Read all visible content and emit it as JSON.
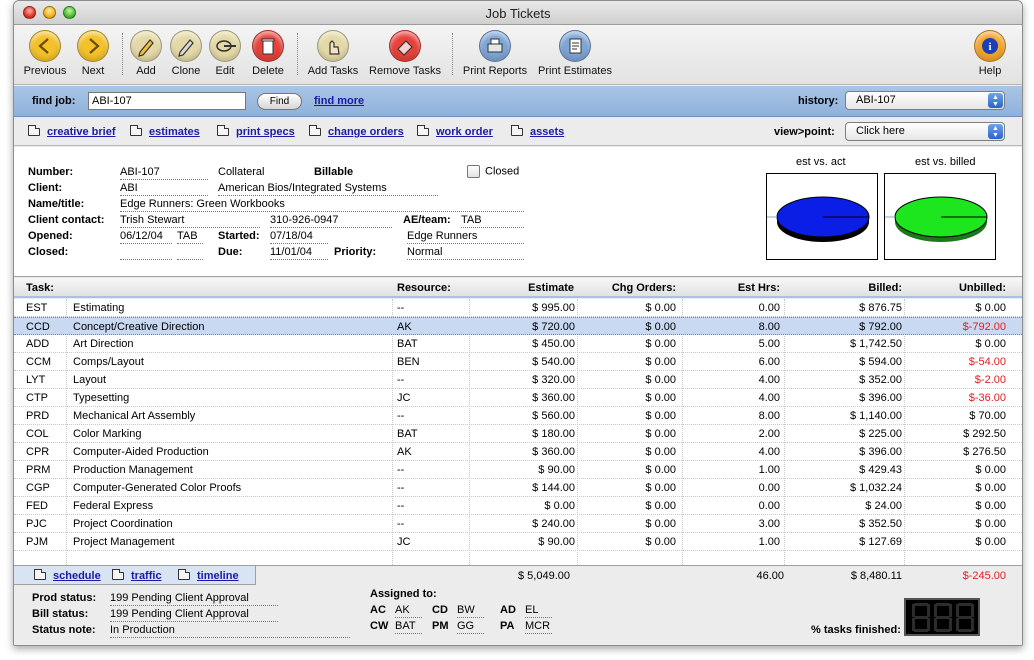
{
  "window": {
    "title": "Job Tickets"
  },
  "toolbar": {
    "items": [
      {
        "label": "Previous",
        "icon": "arrow-left-icon",
        "color": "#f3c12a"
      },
      {
        "label": "Next",
        "icon": "arrow-right-icon",
        "color": "#f3c12a"
      },
      {
        "label": "Add",
        "icon": "pencil-icon",
        "color": "#e4d9a6"
      },
      {
        "label": "Clone",
        "icon": "pencil-clone-icon",
        "color": "#e4d9a6"
      },
      {
        "label": "Edit",
        "icon": "pen-edit-icon",
        "color": "#e4d9a6"
      },
      {
        "label": "Delete",
        "icon": "trash-icon",
        "color": "#e8413a"
      },
      {
        "label": "Add Tasks",
        "icon": "hand-add-icon",
        "color": "#e4d9a6"
      },
      {
        "label": "Remove Tasks",
        "icon": "eraser-icon",
        "color": "#e8413a"
      },
      {
        "label": "Print Reports",
        "icon": "printer-icon",
        "color": "#7da5d6"
      },
      {
        "label": "Print Estimates",
        "icon": "document-print-icon",
        "color": "#7da5d6"
      },
      {
        "label": "Help",
        "icon": "info-icon",
        "color": "#f3a52a"
      }
    ]
  },
  "findbar": {
    "label": "find job:",
    "value": "ABI-107",
    "button": "Find",
    "more_link": "find more",
    "history_label": "history:",
    "history_value": "ABI-107"
  },
  "tabs": {
    "links": [
      "creative brief",
      "estimates",
      "print specs",
      "change orders",
      "work order",
      "assets"
    ],
    "view_label": "view>point:",
    "view_value": "Click here"
  },
  "job": {
    "number_label": "Number:",
    "number": "ABI-107",
    "type": "Collateral",
    "billable": "Billable",
    "closed_label": "Closed",
    "client_label": "Client:",
    "client_code": "ABI",
    "client_name": "American Bios/Integrated Systems",
    "name_label": "Name/title:",
    "name": "Edge Runners:  Green Workbooks",
    "contact_label": "Client contact:",
    "contact": "Trish Stewart",
    "phone": "310-926-0947",
    "ae_label": "AE/team:",
    "ae": "TAB",
    "team": "Edge Runners",
    "opened_label": "Opened:",
    "opened": "06/12/04",
    "opened_by": "TAB",
    "started_label": "Started:",
    "started": "07/18/04",
    "closed_date_label": "Closed:",
    "due_label": "Due:",
    "due": "11/01/04",
    "priority_label": "Priority:",
    "priority": "Normal"
  },
  "pies": {
    "est_vs_act": {
      "title": "est vs. act",
      "color": "#0a1ee6"
    },
    "est_vs_billed": {
      "title": "est vs. billed",
      "color": "#1ee61e"
    }
  },
  "table": {
    "headers": [
      "Task:",
      "Resource:",
      "Estimate",
      "Chg Orders:",
      "Est Hrs:",
      "Billed:",
      "Unbilled:"
    ],
    "rows": [
      {
        "code": "EST",
        "task": "Estimating",
        "resource": "--",
        "estimate": "$ 995.00",
        "chg": "$ 0.00",
        "hrs": "0.00",
        "billed": "$ 876.75",
        "unbilled": "$ 0.00",
        "neg": false
      },
      {
        "code": "CCD",
        "task": "Concept/Creative Direction",
        "resource": "AK",
        "estimate": "$ 720.00",
        "chg": "$ 0.00",
        "hrs": "8.00",
        "billed": "$ 792.00",
        "unbilled": "$-792.00",
        "neg": true,
        "selected": true
      },
      {
        "code": "ADD",
        "task": "Art Direction",
        "resource": "BAT",
        "estimate": "$ 450.00",
        "chg": "$ 0.00",
        "hrs": "5.00",
        "billed": "$ 1,742.50",
        "unbilled": "$ 0.00",
        "neg": false
      },
      {
        "code": "CCM",
        "task": "Comps/Layout",
        "resource": "BEN",
        "estimate": "$ 540.00",
        "chg": "$ 0.00",
        "hrs": "6.00",
        "billed": "$ 594.00",
        "unbilled": "$-54.00",
        "neg": true
      },
      {
        "code": "LYT",
        "task": "Layout",
        "resource": "--",
        "estimate": "$ 320.00",
        "chg": "$ 0.00",
        "hrs": "4.00",
        "billed": "$ 352.00",
        "unbilled": "$-2.00",
        "neg": true
      },
      {
        "code": "CTP",
        "task": "Typesetting",
        "resource": "JC",
        "estimate": "$ 360.00",
        "chg": "$ 0.00",
        "hrs": "4.00",
        "billed": "$ 396.00",
        "unbilled": "$-36.00",
        "neg": true
      },
      {
        "code": "PRD",
        "task": "Mechanical Art Assembly",
        "resource": "--",
        "estimate": "$ 560.00",
        "chg": "$ 0.00",
        "hrs": "8.00",
        "billed": "$ 1,140.00",
        "unbilled": "$ 70.00",
        "neg": false
      },
      {
        "code": "COL",
        "task": "Color Marking",
        "resource": "BAT",
        "estimate": "$ 180.00",
        "chg": "$ 0.00",
        "hrs": "2.00",
        "billed": "$ 225.00",
        "unbilled": "$ 292.50",
        "neg": false
      },
      {
        "code": "CPR",
        "task": "Computer-Aided Production",
        "resource": "AK",
        "estimate": "$ 360.00",
        "chg": "$ 0.00",
        "hrs": "4.00",
        "billed": "$ 396.00",
        "unbilled": "$ 276.50",
        "neg": false
      },
      {
        "code": "PRM",
        "task": "Production Management",
        "resource": "--",
        "estimate": "$ 90.00",
        "chg": "$ 0.00",
        "hrs": "1.00",
        "billed": "$ 429.43",
        "unbilled": "$ 0.00",
        "neg": false
      },
      {
        "code": "CGP",
        "task": "Computer-Generated Color Proofs",
        "resource": "--",
        "estimate": "$ 144.00",
        "chg": "$ 0.00",
        "hrs": "0.00",
        "billed": "$ 1,032.24",
        "unbilled": "$ 0.00",
        "neg": false
      },
      {
        "code": "FED",
        "task": "Federal Express",
        "resource": "--",
        "estimate": "$ 0.00",
        "chg": "$ 0.00",
        "hrs": "0.00",
        "billed": "$ 24.00",
        "unbilled": "$ 0.00",
        "neg": false
      },
      {
        "code": "PJC",
        "task": "Project Coordination",
        "resource": "--",
        "estimate": "$ 240.00",
        "chg": "$ 0.00",
        "hrs": "3.00",
        "billed": "$ 352.50",
        "unbilled": "$ 0.00",
        "neg": false
      },
      {
        "code": "PJM",
        "task": "Project Management",
        "resource": "JC",
        "estimate": "$ 90.00",
        "chg": "$ 0.00",
        "hrs": "1.00",
        "billed": "$ 127.69",
        "unbilled": "$ 0.00",
        "neg": false
      }
    ]
  },
  "bottom": {
    "links": [
      "schedule",
      "traffic",
      "timeline"
    ],
    "totals": {
      "estimate": "$ 5,049.00",
      "hrs": "46.00",
      "billed": "$ 8,480.11",
      "unbilled": "$-245.00"
    },
    "prod_status_label": "Prod status:",
    "prod_status": "199  Pending Client Approval",
    "bill_status_label": "Bill status:",
    "bill_status": "199  Pending Client Approval",
    "status_note_label": "Status note:",
    "status_note": "In Production",
    "assigned_label": "Assigned to:",
    "assigned": [
      {
        "role": "AC",
        "who": "AK"
      },
      {
        "role": "CD",
        "who": "BW"
      },
      {
        "role": "AD",
        "who": "EL"
      },
      {
        "role": "CW",
        "who": "BAT"
      },
      {
        "role": "PM",
        "who": "GG"
      },
      {
        "role": "PA",
        "who": "MCR"
      }
    ],
    "tasks_finished_label": "% tasks finished:"
  }
}
